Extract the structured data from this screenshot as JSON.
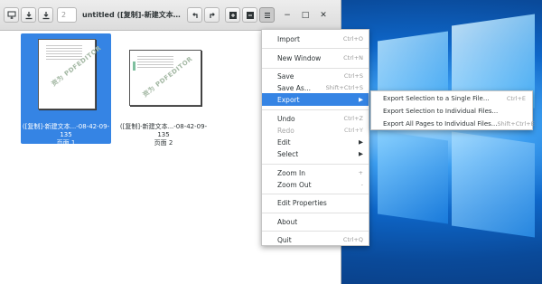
{
  "window": {
    "title": "untitled ([复制]-新建文本文档 (2...",
    "page_number_placeholder": "2",
    "toolbar_icons": [
      "insert-page-icon",
      "save-icon",
      "export-icon",
      "rotate-left-icon",
      "rotate-right-icon",
      "zoom-in-icon",
      "zoom-out-icon",
      "hamburger-menu-icon"
    ],
    "controls": {
      "minimize": "−",
      "maximize": "□",
      "close": "✕"
    }
  },
  "pages": [
    {
      "line1": "([复制]-新建文本...-08-42-09-135",
      "line2": "页面 1",
      "selected": true,
      "watermark": "资为 PDFEDITOR"
    },
    {
      "line1": "([复制]-新建文本...-08-42-09-135",
      "line2": "页面 2",
      "selected": false,
      "watermark": "资为 PDFEDITOR"
    }
  ],
  "menu": {
    "items": [
      {
        "label": "Import",
        "accel": "Ctrl+O"
      },
      {
        "label": "New Window",
        "accel": "Ctrl+N"
      },
      {
        "label": "Save",
        "accel": "Ctrl+S"
      },
      {
        "label": "Save As...",
        "accel": "Shift+Ctrl+S"
      },
      {
        "label": "Export",
        "accel": "▶"
      },
      {
        "label": "Undo",
        "accel": "Ctrl+Z"
      },
      {
        "label": "Redo",
        "accel": "Ctrl+Y"
      },
      {
        "label": "Edit",
        "accel": "▶"
      },
      {
        "label": "Select",
        "accel": "▶"
      },
      {
        "label": "Zoom In",
        "accel": "+"
      },
      {
        "label": "Zoom Out",
        "accel": "-"
      },
      {
        "label": "Edit Properties",
        "accel": ""
      },
      {
        "label": "About",
        "accel": ""
      },
      {
        "label": "Quit",
        "accel": "Ctrl+Q"
      }
    ],
    "highlight_color": "#3584e4"
  },
  "submenu": {
    "items": [
      {
        "label": "Export Selection to a Single File...",
        "accel": "Ctrl+E"
      },
      {
        "label": "Export Selection to Individual Files...",
        "accel": ""
      },
      {
        "label": "Export All Pages to Individual Files...",
        "accel": "Shift+Ctrl+E"
      }
    ]
  }
}
